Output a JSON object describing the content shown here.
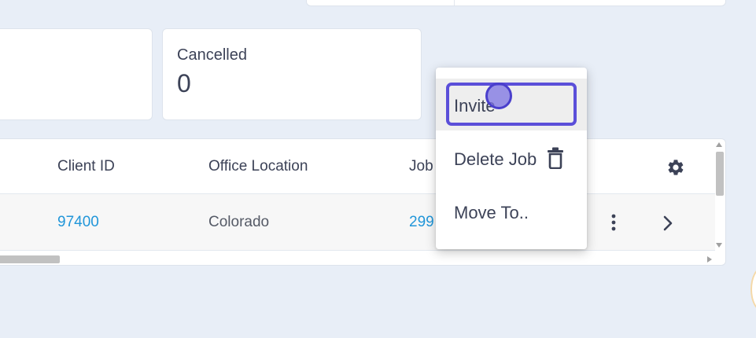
{
  "stats": {
    "cancelled_label": "Cancelled",
    "cancelled_value": "0"
  },
  "table": {
    "headers": [
      "Client ID",
      "Office Location",
      "Job"
    ],
    "row": {
      "client_id": "97400",
      "office_location": "Colorado",
      "job": "299"
    }
  },
  "context_menu": {
    "items": [
      {
        "label": "Invite"
      },
      {
        "label": "Delete Job"
      },
      {
        "label": "Move To.."
      }
    ]
  },
  "icons": {
    "settings": "gear-icon",
    "more": "kebab-icon",
    "open": "chevron-right-icon",
    "delete": "trash-icon"
  },
  "colors": {
    "background": "#e8eef7",
    "link": "#2196d9",
    "focus": "#5b4fd9"
  }
}
